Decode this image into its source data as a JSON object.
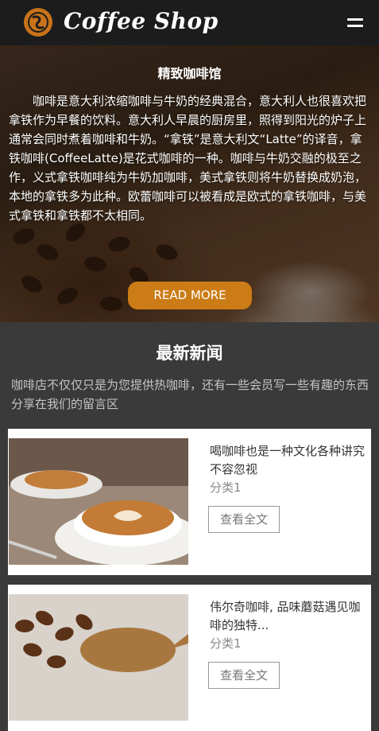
{
  "header": {
    "brand": "Coffee Shop",
    "logo_icon": "coffee-bean-logo-icon",
    "menu_icon": "hamburger-menu-icon"
  },
  "hero": {
    "title": "精致咖啡馆",
    "text": "咖啡是意大利浓缩咖啡与牛奶的经典混合，意大利人也很喜欢把拿铁作为早餐的饮料。意大利人早晨的厨房里，照得到阳光的炉子上通常会同时煮着咖啡和牛奶。“拿铁”是意大利文“Latte”的译音，拿铁咖啡(CoffeeLatte)是花式咖啡的一种。咖啡与牛奶交融的极至之作，义式拿铁咖啡纯为牛奶加咖啡，美式拿铁则将牛奶替换成奶泡，本地的拿铁多为此种。欧蕾咖啡可以被看成是欧式的拿铁咖啡，与美式拿铁和拿铁都不太相同。",
    "button": "READ MORE"
  },
  "news": {
    "title": "最新新闻",
    "desc": "咖啡店不仅仅只是为您提供热咖啡，还有一些会员写一些有趣的东西分享在我们的留言区",
    "items": [
      {
        "title": "喝咖啡也是一种文化各种讲究不容忽视",
        "category": "分类1",
        "button": "查看全文"
      },
      {
        "title": "伟尔奇咖啡, 品味蘑菇遇见咖啡的独特...",
        "category": "分类1",
        "button": "查看全文"
      }
    ]
  },
  "colors": {
    "header_bg": "#1c1c1c",
    "accent": "#cc7c16",
    "section_bg": "#3a3a3a"
  }
}
